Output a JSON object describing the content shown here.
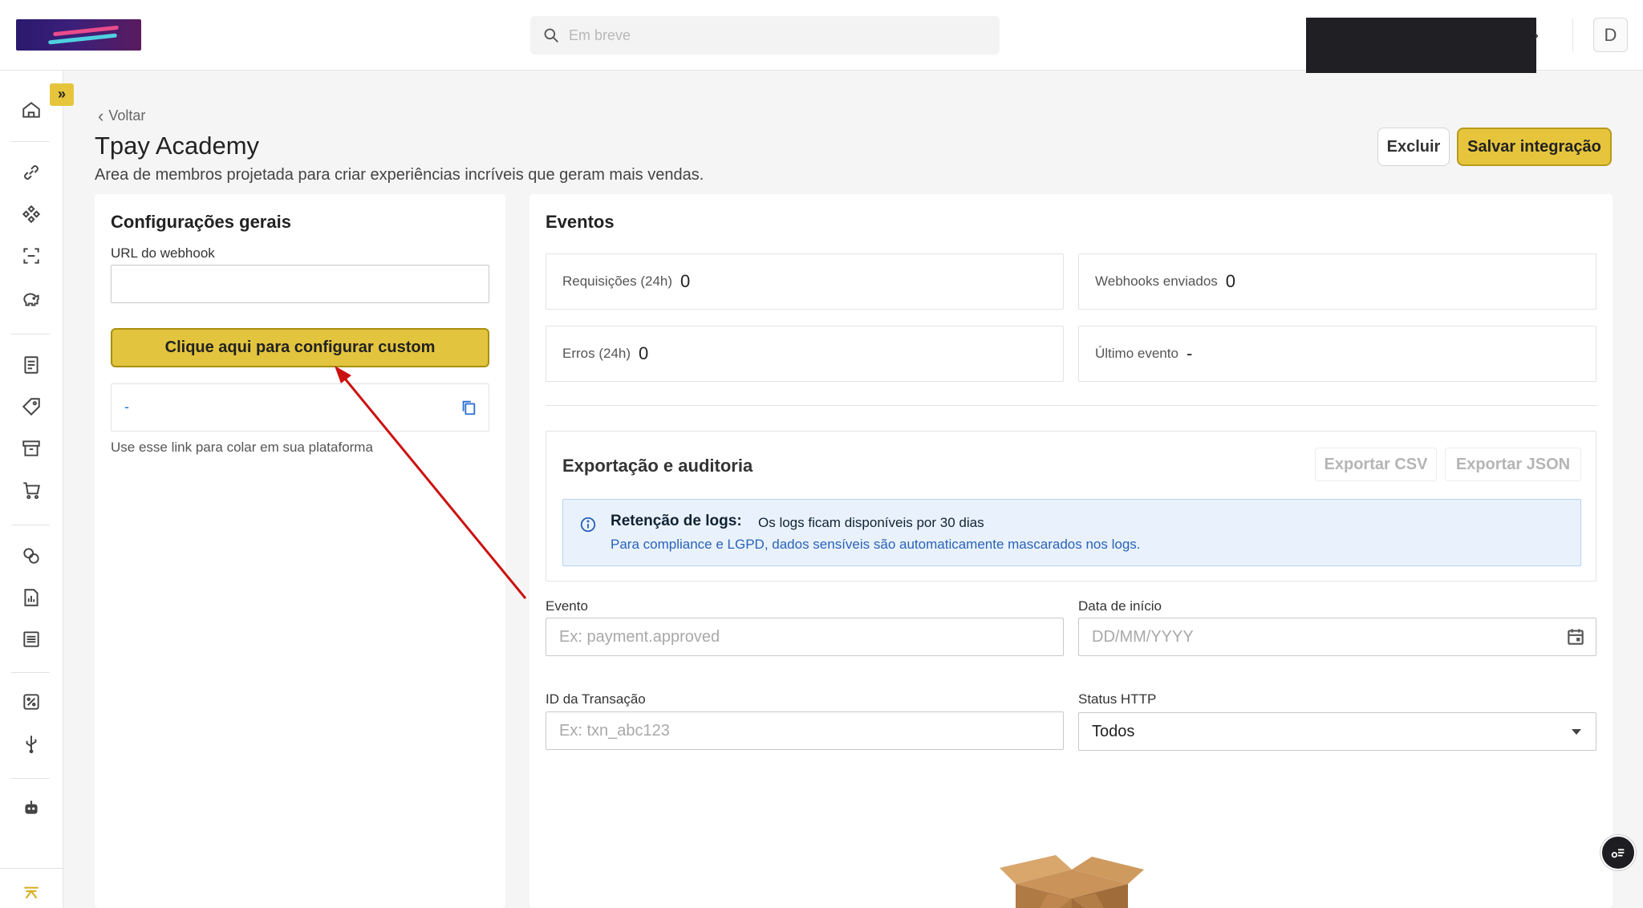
{
  "header": {
    "search_placeholder": "Em breve",
    "avatar_initial": "D"
  },
  "nav": {
    "back_label": "Voltar"
  },
  "page": {
    "title": "Tpay Academy",
    "subtitle": "Area de membros projetada para criar experiências incríveis que geram mais vendas.",
    "delete_label": "Excluir",
    "save_label": "Salvar integração"
  },
  "general": {
    "title": "Configurações gerais",
    "webhook_label": "URL do webhook",
    "webhook_value": "",
    "config_button": "Clique aqui para configurar custom",
    "link_value": "-",
    "hint": "Use esse link para colar em sua plataforma"
  },
  "events": {
    "title": "Eventos",
    "stats": [
      {
        "label": "Requisições (24h)",
        "value": "0"
      },
      {
        "label": "Webhooks enviados",
        "value": "0"
      },
      {
        "label": "Erros (24h)",
        "value": "0"
      },
      {
        "label": "Último evento",
        "value": "-"
      }
    ]
  },
  "export": {
    "title": "Exportação e auditoria",
    "csv_label": "Exportar CSV",
    "json_label": "Exportar JSON",
    "info_title": "Retenção de logs:",
    "info_text": "Os logs ficam disponíveis por 30 dias",
    "info_sub": "Para compliance e LGPD, dados sensíveis são automaticamente mascarados nos logs."
  },
  "filters": {
    "event_label": "Evento",
    "event_placeholder": "Ex: payment.approved",
    "start_label": "Data de início",
    "start_placeholder": "DD/MM/YYYY",
    "txn_label": "ID da Transação",
    "txn_placeholder": "Ex: txn_abc123",
    "status_label": "Status HTTP",
    "status_value": "Todos"
  },
  "colors": {
    "accent": "#e3c43e",
    "link": "#2a6fd6",
    "annotation_arrow": "#cc1111"
  }
}
